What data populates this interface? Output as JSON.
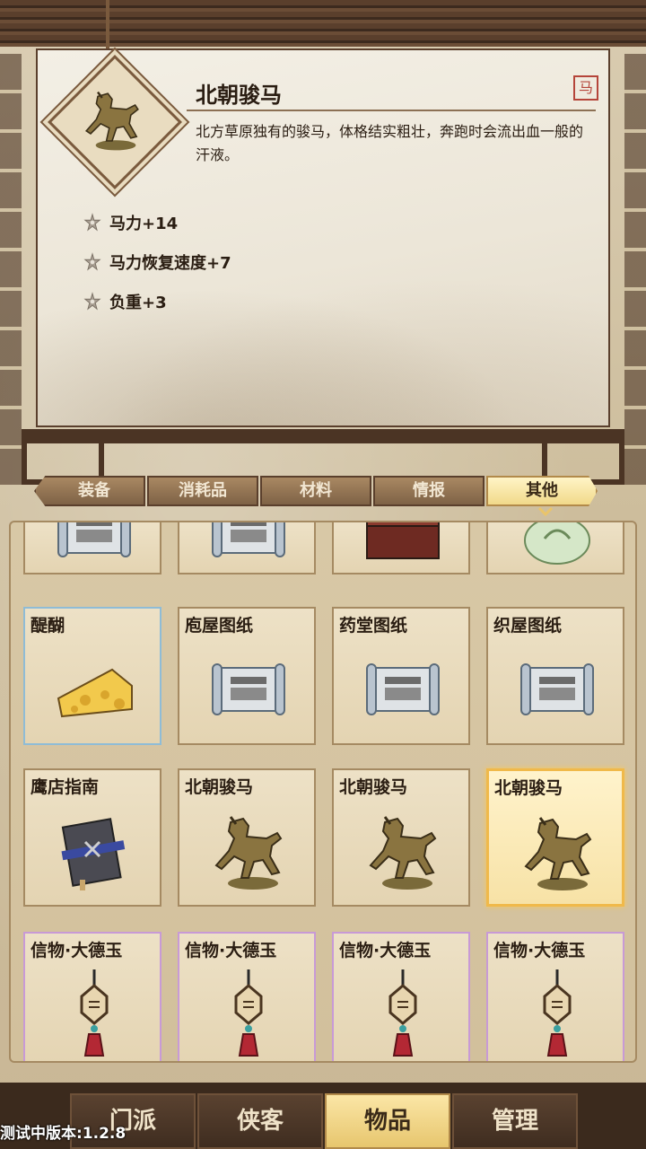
{
  "detail": {
    "title": "北朝骏马",
    "tag": "马",
    "description": "北方草原独有的骏马，体格结实粗壮，奔跑时会流出血一般的汗液。",
    "icon": "horse-statue-icon",
    "stats": [
      "马力+14",
      "马力恢复速度+7",
      "负重+3"
    ]
  },
  "tabs": [
    {
      "label": "装备",
      "active": false
    },
    {
      "label": "消耗品",
      "active": false
    },
    {
      "label": "材料",
      "active": false
    },
    {
      "label": "情报",
      "active": false
    },
    {
      "label": "其他",
      "active": true
    }
  ],
  "inventory": {
    "rows": [
      [
        {
          "label": "",
          "icon": "scroll-icon"
        },
        {
          "label": "",
          "icon": "scroll-icon"
        },
        {
          "label": "",
          "icon": "chest-icon"
        },
        {
          "label": "",
          "icon": "jade-plate-icon"
        }
      ],
      [
        {
          "label": "醍醐",
          "icon": "cheese-icon"
        },
        {
          "label": "庖屋图纸",
          "icon": "blueprint-scroll-icon"
        },
        {
          "label": "药堂图纸",
          "icon": "blueprint-scroll-icon"
        },
        {
          "label": "织屋图纸",
          "icon": "blueprint-scroll-icon"
        }
      ],
      [
        {
          "label": "鹰店指南",
          "icon": "book-icon"
        },
        {
          "label": "北朝骏马",
          "icon": "horse-statue-icon"
        },
        {
          "label": "北朝骏马",
          "icon": "horse-statue-icon"
        },
        {
          "label": "北朝骏马",
          "icon": "horse-statue-icon",
          "selected": true
        }
      ],
      [
        {
          "label": "信物·大德玉",
          "icon": "jade-pendant-icon"
        },
        {
          "label": "信物·大德玉",
          "icon": "jade-pendant-icon"
        },
        {
          "label": "信物·大德玉",
          "icon": "jade-pendant-icon"
        },
        {
          "label": "信物·大德玉",
          "icon": "jade-pendant-icon"
        }
      ]
    ]
  },
  "nav": [
    {
      "label": "门派",
      "active": false
    },
    {
      "label": "侠客",
      "active": false
    },
    {
      "label": "物品",
      "active": true
    },
    {
      "label": "管理",
      "active": false
    }
  ],
  "version": "测试中版本:1.2.8"
}
